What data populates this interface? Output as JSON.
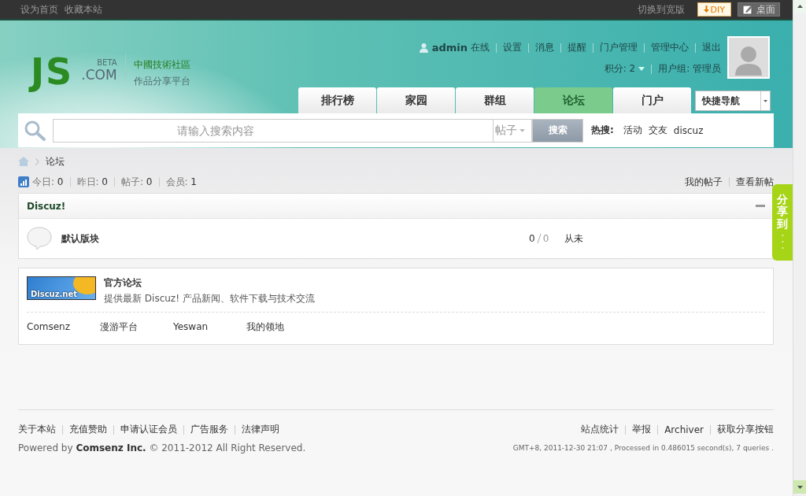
{
  "topbar": {
    "links": [
      "设为首页",
      "收藏本站"
    ],
    "switch_link": "切换到宽版",
    "diy_button": "DIY",
    "desktop_button": "桌面"
  },
  "logo": {
    "mark": "JS",
    "beta": "BETA",
    "domain": ".COM",
    "tagline_1": "中國技術社區",
    "tagline_2": "作品分享平台"
  },
  "user": {
    "name": "admin",
    "status": "在线",
    "links": [
      "设置",
      "消息",
      "提醒",
      "门户管理",
      "管理中心",
      "退出"
    ],
    "credits": "积分: 2",
    "group": "用户组: 管理员"
  },
  "nav": {
    "tabs": [
      {
        "label": "排行榜",
        "selected": false
      },
      {
        "label": "家园",
        "selected": false
      },
      {
        "label": "群组",
        "selected": false
      },
      {
        "label": "论坛",
        "selected": true
      },
      {
        "label": "门户",
        "selected": false
      }
    ],
    "quick_nav": "快捷导航"
  },
  "search": {
    "placeholder": "请输入搜索内容",
    "scope": "帖子",
    "button": "搜索",
    "hot_label": "热搜:",
    "hot_terms": [
      "活动",
      "交友",
      "discuz"
    ]
  },
  "breadcrumb": [
    "论坛"
  ],
  "stats": [
    {
      "label": "今日:",
      "value": "0"
    },
    {
      "label": "昨日:",
      "value": "0"
    },
    {
      "label": "帖子:",
      "value": "0"
    },
    {
      "label": "会员:",
      "value": "1"
    }
  ],
  "user_links": [
    "我的帖子",
    "查看新帖"
  ],
  "categories": [
    {
      "title": "Discuz!",
      "expanded": true,
      "forums": [
        {
          "name": "默认版块",
          "threads": "0",
          "posts": "0",
          "last_post": "从未"
        }
      ]
    }
  ],
  "links": {
    "featured": {
      "logo_text": "Discuz.net",
      "name": "官方论坛",
      "description": "提供最新 Discuz! 产品新闻、软件下载与技术交流"
    },
    "text_links": [
      "Comsenz",
      "漫游平台",
      "Yeswan",
      "我的领地"
    ]
  },
  "footer": {
    "links": [
      "关于本站",
      "充值赞助",
      "申请认证会员",
      "广告服务",
      "法律声明"
    ],
    "powered": "Powered by **Comsenz Inc.** © 2011-2012 All Right Reserved.",
    "right_links": [
      "站点统计",
      "举报",
      "Archiver",
      "获取分享按钮"
    ],
    "debug": "GMT+8, 2011-12-30 21:07 , Processed in 0.486015 second(s), 7 queries ."
  },
  "share_tab": {
    "label": "分享到"
  }
}
